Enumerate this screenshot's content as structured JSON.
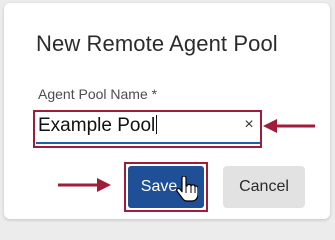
{
  "dialog": {
    "title": "New Remote Agent Pool"
  },
  "form": {
    "field_label": "Agent Pool Name *",
    "field_value": "Example Pool",
    "clear_glyph": "×"
  },
  "buttons": {
    "save_label": "Save",
    "cancel_label": "Cancel"
  },
  "icons": {
    "clear": "close-icon",
    "annotation_arrow": "arrow-icon",
    "cursor": "hand-pointer-icon"
  },
  "colors": {
    "primary": "#1f4f96",
    "input_underline": "#1f5ea8",
    "annotation": "#a11b3b",
    "cancel_bg": "#e2e2e2"
  }
}
